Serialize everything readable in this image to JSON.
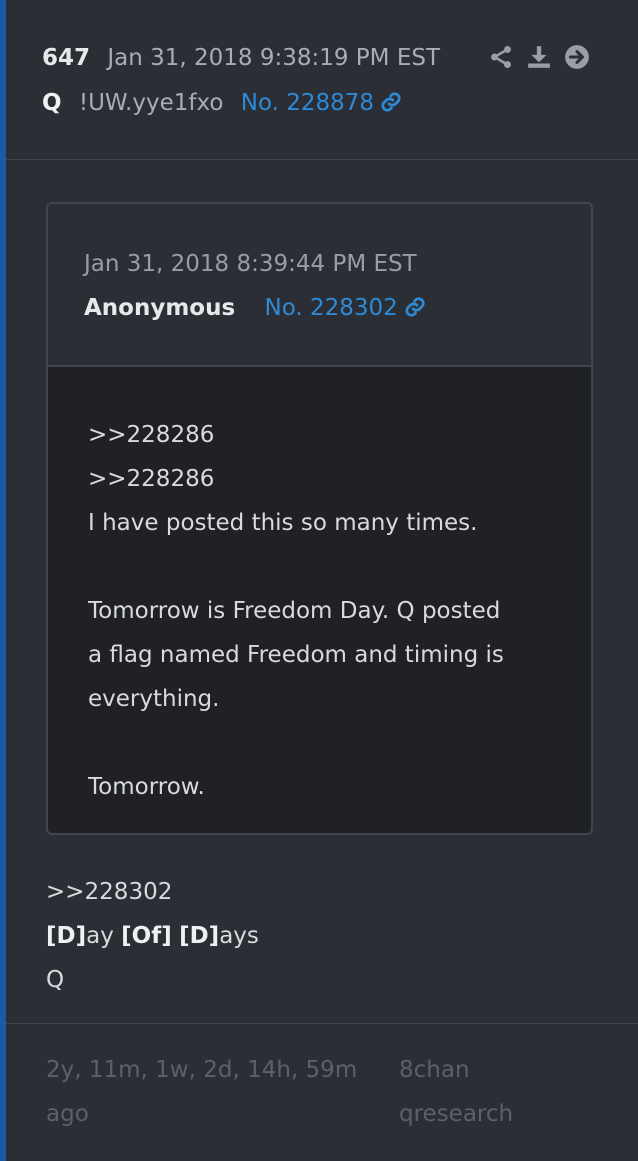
{
  "post": {
    "number": "647",
    "date": "Jan 31, 2018 9:38:19 PM EST",
    "author": "Q",
    "tripcode": "!UW.yye1fxo",
    "post_no": "No. 228878"
  },
  "quoted": {
    "date": "Jan 31, 2018 8:39:44 PM EST",
    "author": "Anonymous",
    "post_no": "No. 228302",
    "lines": [
      ">>228286",
      ">>228286",
      "I have posted this so many times.",
      "Tomorrow is Freedom Day. Q posted",
      "a flag named Freedom and timing is",
      "everything.",
      "Tomorrow."
    ]
  },
  "reply": {
    "ref": ">>228302",
    "d1": "[D]",
    "ay": "ay ",
    "of": "[Of]",
    "sp": " ",
    "d2": "[D]",
    "ays": "ays",
    "sign": "Q"
  },
  "footer": {
    "elapsed": "2y, 11m, 1w, 2d, 14h, 59m ago",
    "source": "8chan qresearch"
  },
  "icons": [
    "share-icon",
    "download-icon",
    "arrow-right-circle-icon",
    "link-icon"
  ],
  "colors": {
    "accent": "#1c5aa6",
    "link": "#2d8ad6"
  }
}
